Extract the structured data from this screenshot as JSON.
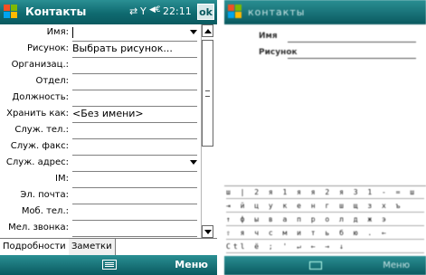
{
  "left": {
    "title": "Контакты",
    "status_icons": [
      "⇄",
      "Y",
      "◀€"
    ],
    "clock": "22:11",
    "ok_label": "ok",
    "fields": [
      {
        "label": "Имя:",
        "value": "",
        "dropdown": true,
        "caret": true
      },
      {
        "label": "Рисунок:",
        "value": "Выбрать рисунок...",
        "dropdown": false
      },
      {
        "label": "Организац.:",
        "value": "",
        "dropdown": false
      },
      {
        "label": "Отдел:",
        "value": "",
        "dropdown": false
      },
      {
        "label": "Должность:",
        "value": "",
        "dropdown": false
      },
      {
        "label": "Хранить как:",
        "value": "<Без имени>",
        "dropdown": false
      },
      {
        "label": "Служ. тел.:",
        "value": "",
        "dropdown": false
      },
      {
        "label": "Служ. факс:",
        "value": "",
        "dropdown": false
      },
      {
        "label": "Служ. адрес:",
        "value": "",
        "dropdown": true
      },
      {
        "label": "IM:",
        "value": "",
        "dropdown": false
      },
      {
        "label": "Эл. почта:",
        "value": "",
        "dropdown": false
      },
      {
        "label": "Моб. тел.:",
        "value": "",
        "dropdown": false
      },
      {
        "label": "Мел. звонка:",
        "value": "",
        "dropdown": false
      }
    ],
    "tabs": [
      "Подробности",
      "Заметки"
    ],
    "menu_label": "Меню",
    "colors": {
      "titlebar": "#0f6a70",
      "accent": "#2a8f93"
    }
  },
  "right": {
    "title": "контакты",
    "fields": [
      {
        "label": "Имя"
      },
      {
        "label": "Рисунок"
      }
    ],
    "keyboard_rows": [
      "ш | 2 я 1 я я 2 я 3 1 - = ш",
      "⇥ й ц у к е н г ш щ з х ъ",
      "↑ ф ы в а п р о л д ж э",
      "⇧ я ч с м и т ь б ю . ←",
      "Ctl ё ; ' ↵ ← → ↓"
    ],
    "menu_label": "Меню"
  }
}
